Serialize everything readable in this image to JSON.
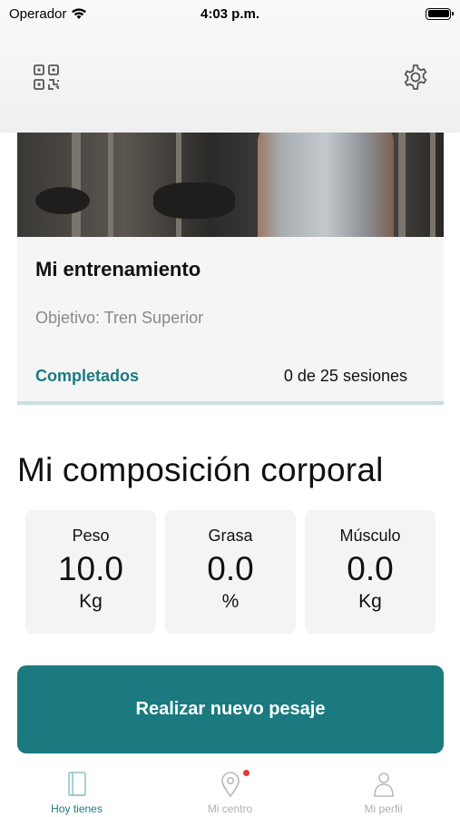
{
  "status_bar": {
    "carrier": "Operador",
    "time": "4:03 p.m."
  },
  "header": {
    "left_icon": "qr-code-icon",
    "right_icon": "gear-icon"
  },
  "training_card": {
    "title": "Mi entrenamiento",
    "objective": "Objetivo: Tren Superior",
    "completed_label": "Completados",
    "sessions": "0 de 25 sesiones"
  },
  "body_composition": {
    "title": "Mi composición corporal",
    "metrics": [
      {
        "label": "Peso",
        "value": "10.0",
        "unit": "Kg"
      },
      {
        "label": "Grasa",
        "value": "0.0",
        "unit": "%"
      },
      {
        "label": "Músculo",
        "value": "0.0",
        "unit": "Kg"
      }
    ]
  },
  "cta": {
    "label": "Realizar nuevo pesaje"
  },
  "tabbar": {
    "items": [
      {
        "label": "Hoy tienes",
        "icon": "book-icon",
        "active": true
      },
      {
        "label": "Mi centro",
        "icon": "location-pin-icon",
        "active": false,
        "badge": true
      },
      {
        "label": "Mi perfil",
        "icon": "person-icon",
        "active": false
      }
    ]
  },
  "colors": {
    "accent": "#1a7a80",
    "badge": "#e53935",
    "inactive": "#b0b0b0"
  }
}
